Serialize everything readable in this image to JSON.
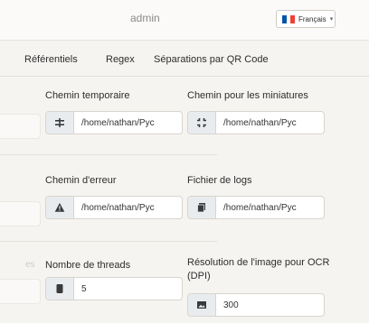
{
  "header": {
    "user_label": "admin",
    "language": "Français",
    "language_caret": "▾",
    "flag_colors": [
      "#0055a4",
      "#ffffff",
      "#ef4135"
    ]
  },
  "tabs": [
    {
      "label": "Référentiels"
    },
    {
      "label": "Regex"
    },
    {
      "label": "Séparations par QR Code"
    }
  ],
  "form": {
    "temp_path": {
      "label": "Chemin temporaire",
      "value": "/home/nathan/Pyc",
      "icon": "grip-lines-icon"
    },
    "thumb_path": {
      "label": "Chemin pour les miniatures",
      "value": "/home/nathan/Pyc",
      "icon": "compress-icon"
    },
    "error_path": {
      "label": "Chemin d'erreur",
      "value": "/home/nathan/Pyc",
      "icon": "warning-icon"
    },
    "log_file": {
      "label": "Fichier de logs",
      "value": "/home/nathan/Pyc",
      "icon": "copy-icon"
    },
    "threads": {
      "label": "Nombre de threads",
      "value": "5",
      "icon": "server-icon"
    },
    "ocr_dpi": {
      "label": "Résolution de l'image pour OCR (DPI)",
      "value": "300",
      "icon": "image-icon"
    }
  },
  "left_fragments": {
    "row1": "p",
    "row2": "d",
    "row3_label": "es",
    "row3_value": "c"
  },
  "colors": {
    "accent_icon": "#3a3a3a",
    "addon_bg": "#e9ecef"
  }
}
